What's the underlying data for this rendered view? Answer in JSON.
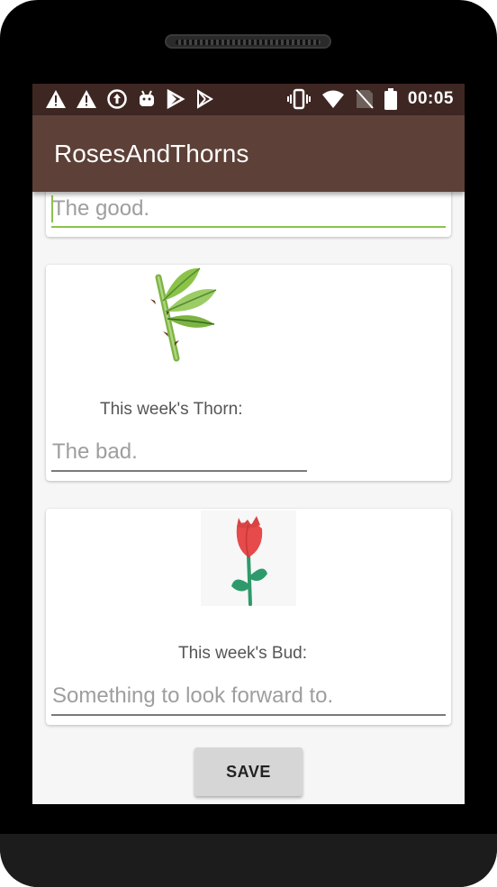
{
  "status_bar": {
    "time": "00:05",
    "icons_left": [
      "warning-icon",
      "warning-icon",
      "sync-icon",
      "android-icon",
      "play-store-icon",
      "play-store-icon"
    ],
    "icons_right": [
      "vibrate-icon",
      "wifi-icon",
      "no-sim-icon",
      "battery-icon"
    ]
  },
  "app_bar": {
    "title": "RosesAndThorns"
  },
  "rose_card": {
    "input_placeholder": "The good."
  },
  "thorn_card": {
    "image": "thorn-branch-image",
    "label": "This week's Thorn:",
    "input_placeholder": "The bad."
  },
  "bud_card": {
    "image": "rosebud-image",
    "label": "This week's Bud:",
    "input_placeholder": "Something to look forward to."
  },
  "save_button": {
    "label": "SAVE"
  },
  "colors": {
    "status_bar": "#3e2723",
    "app_bar": "#5d4037",
    "focus_accent": "#8bc34a"
  }
}
